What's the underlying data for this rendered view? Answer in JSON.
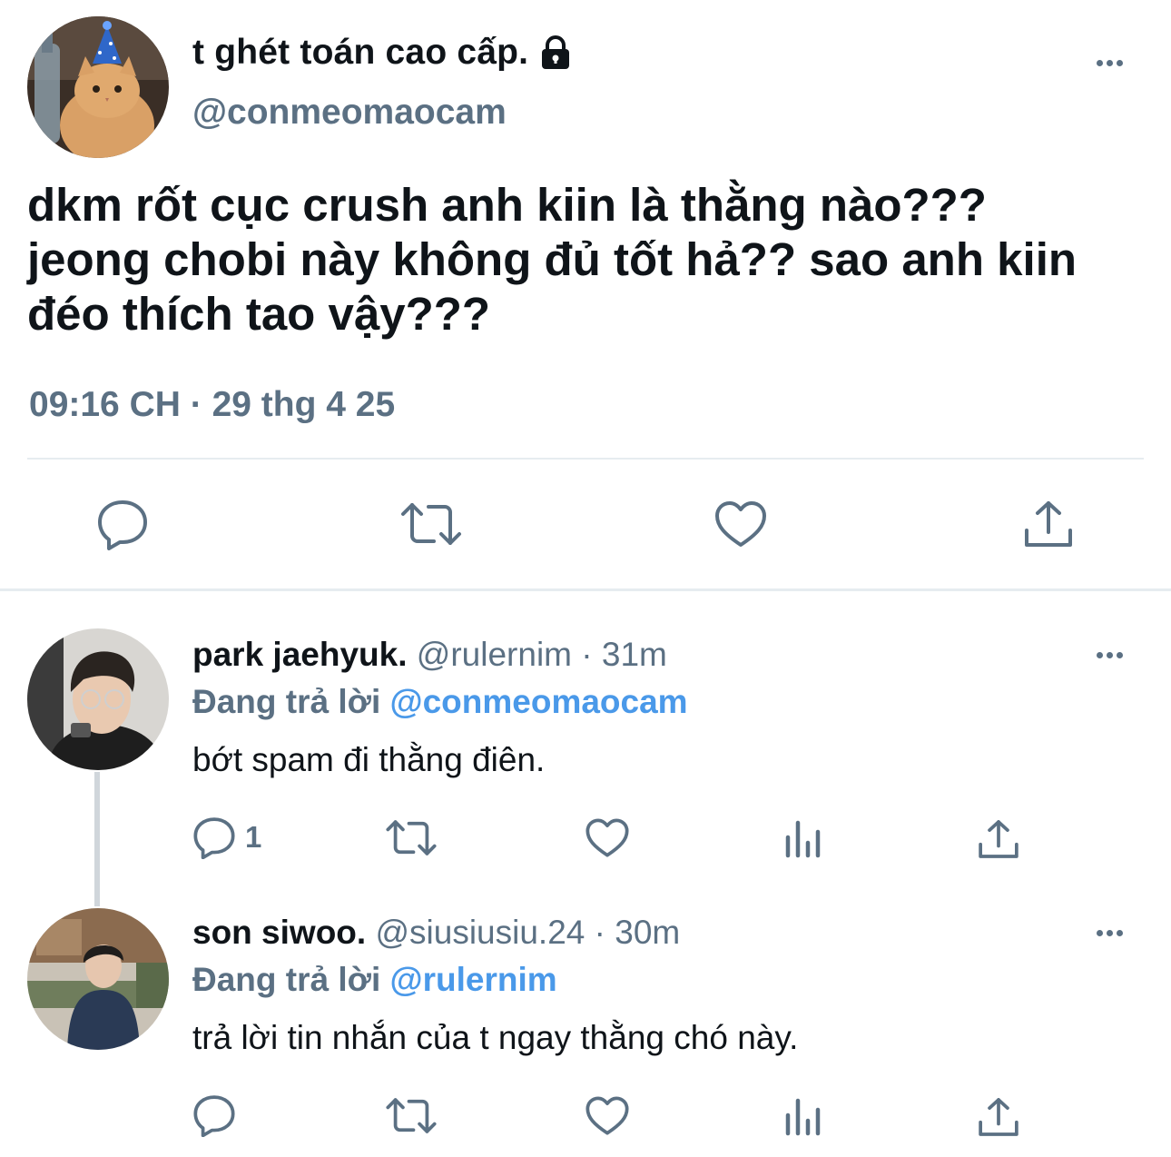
{
  "main_tweet": {
    "display_name": "t ghét toán cao cấp.",
    "handle": "@conmeomaocam",
    "text_lines": [
      "dkm rốt cục crush anh kiin là thằng nào???",
      "jeong chobi này không đủ tốt hả?? sao anh kiin",
      "đéo thích tao vậy???"
    ],
    "timestamp": "09:16 CH · 29 thg 4 25",
    "icons": [
      "reply-icon",
      "retweet-icon",
      "like-icon",
      "share-icon"
    ]
  },
  "replies": [
    {
      "display_name": "park jaehyuk.",
      "meta": "@rulernim · 31m",
      "replying_prefix": "Đang trả lời",
      "replying_to": "@conmeomaocam",
      "text": "bớt spam đi thằng điên.",
      "reply_count": "1"
    },
    {
      "display_name": "son siwoo.",
      "meta": "@siusiusiu.24 · 30m",
      "replying_prefix": "Đang trả lời",
      "replying_to": "@rulernim",
      "text": "trả lời tin nhắn của t ngay thằng chó này.",
      "reply_count": ""
    }
  ],
  "colors": {
    "text": "#0f1419",
    "secondary": "#5b7083",
    "link": "#4a99e9",
    "divider": "#e6ecf0"
  }
}
